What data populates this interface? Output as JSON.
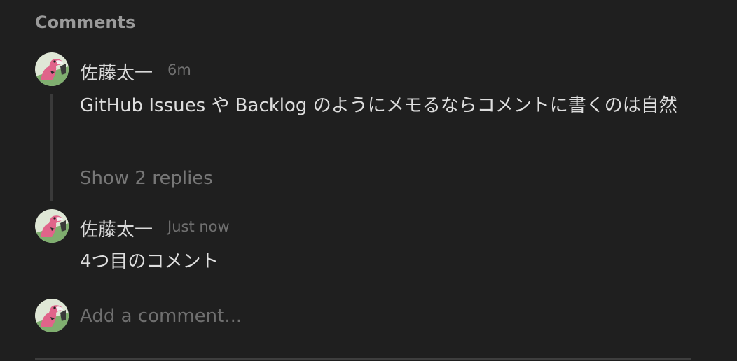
{
  "section": {
    "title": "Comments"
  },
  "comments": [
    {
      "author": "佐藤太一",
      "time": "6m",
      "text": "GitHub Issues や Backlog のようにメモるならコメントに書くのは自然",
      "replies_label": "Show 2 replies"
    },
    {
      "author": "佐藤太一",
      "time": "Just now",
      "text": "4つ目のコメント"
    }
  ],
  "composer": {
    "placeholder": "Add a comment..."
  },
  "avatar_icon": "dinosaur-avatar-icon",
  "colors": {
    "background": "#1f1f1f",
    "muted": "#777777",
    "text": "#dedede"
  }
}
